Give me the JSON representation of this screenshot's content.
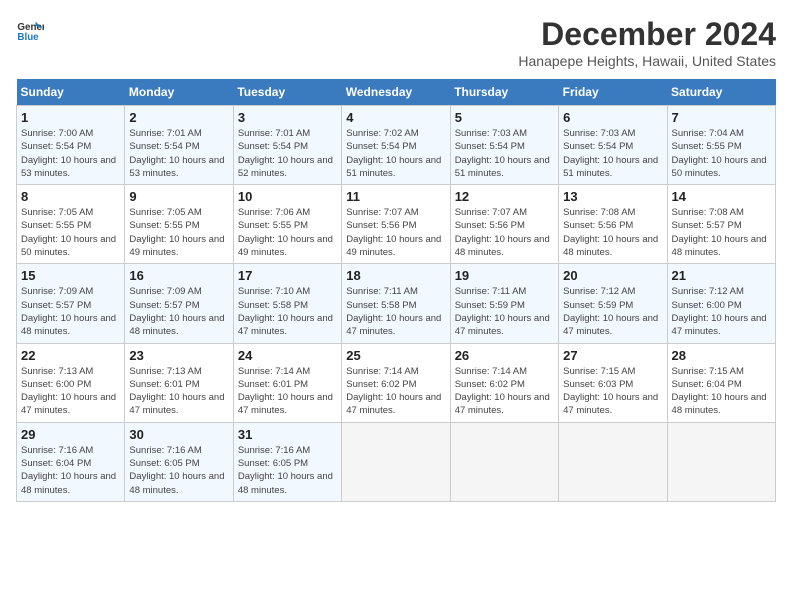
{
  "header": {
    "logo_line1": "General",
    "logo_line2": "Blue",
    "month_year": "December 2024",
    "location": "Hanapepe Heights, Hawaii, United States"
  },
  "weekdays": [
    "Sunday",
    "Monday",
    "Tuesday",
    "Wednesday",
    "Thursday",
    "Friday",
    "Saturday"
  ],
  "weeks": [
    [
      {
        "day": "1",
        "sunrise": "7:00 AM",
        "sunset": "5:54 PM",
        "daylight": "10 hours and 53 minutes."
      },
      {
        "day": "2",
        "sunrise": "7:01 AM",
        "sunset": "5:54 PM",
        "daylight": "10 hours and 53 minutes."
      },
      {
        "day": "3",
        "sunrise": "7:01 AM",
        "sunset": "5:54 PM",
        "daylight": "10 hours and 52 minutes."
      },
      {
        "day": "4",
        "sunrise": "7:02 AM",
        "sunset": "5:54 PM",
        "daylight": "10 hours and 51 minutes."
      },
      {
        "day": "5",
        "sunrise": "7:03 AM",
        "sunset": "5:54 PM",
        "daylight": "10 hours and 51 minutes."
      },
      {
        "day": "6",
        "sunrise": "7:03 AM",
        "sunset": "5:54 PM",
        "daylight": "10 hours and 51 minutes."
      },
      {
        "day": "7",
        "sunrise": "7:04 AM",
        "sunset": "5:55 PM",
        "daylight": "10 hours and 50 minutes."
      }
    ],
    [
      {
        "day": "8",
        "sunrise": "7:05 AM",
        "sunset": "5:55 PM",
        "daylight": "10 hours and 50 minutes."
      },
      {
        "day": "9",
        "sunrise": "7:05 AM",
        "sunset": "5:55 PM",
        "daylight": "10 hours and 49 minutes."
      },
      {
        "day": "10",
        "sunrise": "7:06 AM",
        "sunset": "5:55 PM",
        "daylight": "10 hours and 49 minutes."
      },
      {
        "day": "11",
        "sunrise": "7:07 AM",
        "sunset": "5:56 PM",
        "daylight": "10 hours and 49 minutes."
      },
      {
        "day": "12",
        "sunrise": "7:07 AM",
        "sunset": "5:56 PM",
        "daylight": "10 hours and 48 minutes."
      },
      {
        "day": "13",
        "sunrise": "7:08 AM",
        "sunset": "5:56 PM",
        "daylight": "10 hours and 48 minutes."
      },
      {
        "day": "14",
        "sunrise": "7:08 AM",
        "sunset": "5:57 PM",
        "daylight": "10 hours and 48 minutes."
      }
    ],
    [
      {
        "day": "15",
        "sunrise": "7:09 AM",
        "sunset": "5:57 PM",
        "daylight": "10 hours and 48 minutes."
      },
      {
        "day": "16",
        "sunrise": "7:09 AM",
        "sunset": "5:57 PM",
        "daylight": "10 hours and 48 minutes."
      },
      {
        "day": "17",
        "sunrise": "7:10 AM",
        "sunset": "5:58 PM",
        "daylight": "10 hours and 47 minutes."
      },
      {
        "day": "18",
        "sunrise": "7:11 AM",
        "sunset": "5:58 PM",
        "daylight": "10 hours and 47 minutes."
      },
      {
        "day": "19",
        "sunrise": "7:11 AM",
        "sunset": "5:59 PM",
        "daylight": "10 hours and 47 minutes."
      },
      {
        "day": "20",
        "sunrise": "7:12 AM",
        "sunset": "5:59 PM",
        "daylight": "10 hours and 47 minutes."
      },
      {
        "day": "21",
        "sunrise": "7:12 AM",
        "sunset": "6:00 PM",
        "daylight": "10 hours and 47 minutes."
      }
    ],
    [
      {
        "day": "22",
        "sunrise": "7:13 AM",
        "sunset": "6:00 PM",
        "daylight": "10 hours and 47 minutes."
      },
      {
        "day": "23",
        "sunrise": "7:13 AM",
        "sunset": "6:01 PM",
        "daylight": "10 hours and 47 minutes."
      },
      {
        "day": "24",
        "sunrise": "7:14 AM",
        "sunset": "6:01 PM",
        "daylight": "10 hours and 47 minutes."
      },
      {
        "day": "25",
        "sunrise": "7:14 AM",
        "sunset": "6:02 PM",
        "daylight": "10 hours and 47 minutes."
      },
      {
        "day": "26",
        "sunrise": "7:14 AM",
        "sunset": "6:02 PM",
        "daylight": "10 hours and 47 minutes."
      },
      {
        "day": "27",
        "sunrise": "7:15 AM",
        "sunset": "6:03 PM",
        "daylight": "10 hours and 47 minutes."
      },
      {
        "day": "28",
        "sunrise": "7:15 AM",
        "sunset": "6:04 PM",
        "daylight": "10 hours and 48 minutes."
      }
    ],
    [
      {
        "day": "29",
        "sunrise": "7:16 AM",
        "sunset": "6:04 PM",
        "daylight": "10 hours and 48 minutes."
      },
      {
        "day": "30",
        "sunrise": "7:16 AM",
        "sunset": "6:05 PM",
        "daylight": "10 hours and 48 minutes."
      },
      {
        "day": "31",
        "sunrise": "7:16 AM",
        "sunset": "6:05 PM",
        "daylight": "10 hours and 48 minutes."
      },
      null,
      null,
      null,
      null
    ]
  ]
}
